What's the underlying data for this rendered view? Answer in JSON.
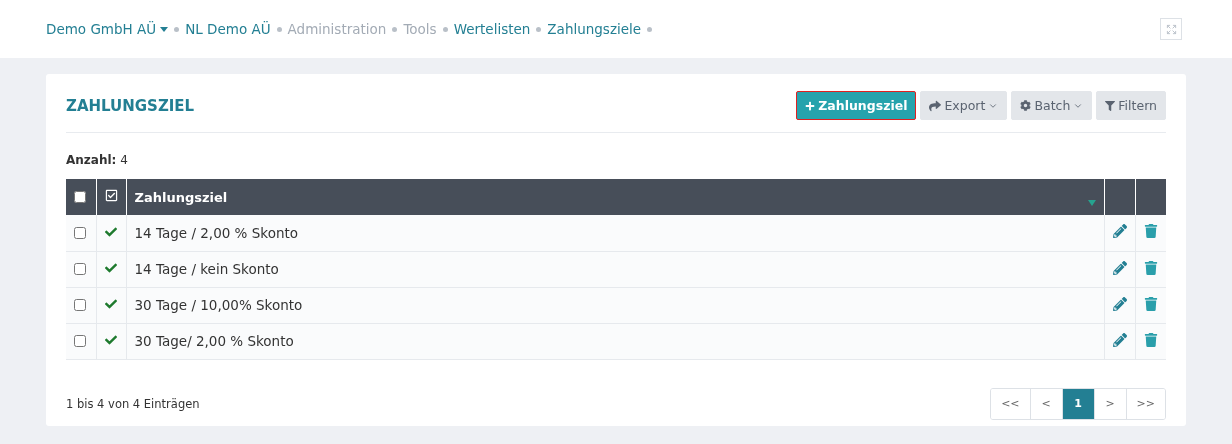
{
  "breadcrumb": [
    {
      "label": "Demo GmbH AÜ",
      "disabled": false,
      "dropdown": true
    },
    {
      "label": "NL Demo AÜ",
      "disabled": false,
      "dropdown": false
    },
    {
      "label": "Administration",
      "disabled": true,
      "dropdown": false
    },
    {
      "label": "Tools",
      "disabled": true,
      "dropdown": false
    },
    {
      "label": "Wertelisten",
      "disabled": false,
      "dropdown": false
    },
    {
      "label": "Zahlungsziele",
      "disabled": false,
      "dropdown": false
    }
  ],
  "title": "ZAHLUNGSZIEL",
  "actions": [
    {
      "kind": "add",
      "label": "Zahlungsziel",
      "primary": true,
      "dropdown": false
    },
    {
      "kind": "export",
      "label": "Export",
      "primary": false,
      "dropdown": true
    },
    {
      "kind": "batch",
      "label": "Batch",
      "primary": false,
      "dropdown": true
    },
    {
      "kind": "filter",
      "label": "Filtern",
      "primary": false,
      "dropdown": false
    }
  ],
  "count": {
    "label": "Anzahl:",
    "value": "4"
  },
  "table": {
    "select_all_checked": false,
    "columns": [
      {
        "label": "Zahlungsziel",
        "sorted": true
      }
    ],
    "rows": [
      {
        "checked": false,
        "active": true,
        "name": "14 Tage / 2,00 % Skonto"
      },
      {
        "checked": false,
        "active": true,
        "name": "14 Tage / kein Skonto"
      },
      {
        "checked": false,
        "active": true,
        "name": "30 Tage / 10,00% Skonto"
      },
      {
        "checked": false,
        "active": true,
        "name": "30 Tage/ 2,00 % Skonto"
      }
    ]
  },
  "summary": "1 bis 4 von 4 Einträgen",
  "pagination": [
    {
      "label": "<<",
      "selected": false
    },
    {
      "label": "<",
      "selected": false
    },
    {
      "label": "1",
      "selected": true
    },
    {
      "label": ">",
      "selected": false
    },
    {
      "label": ">>",
      "selected": false
    }
  ]
}
